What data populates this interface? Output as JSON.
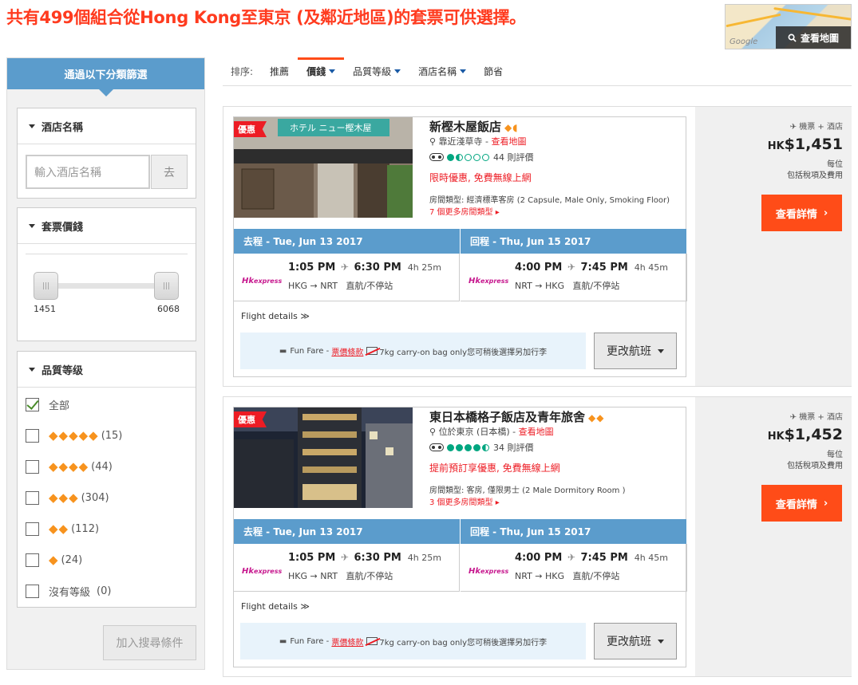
{
  "page_title": "共有499個組合從Hong Kong至東京 (及鄰近地區)的套票可供選擇。",
  "map": {
    "button_label": "查看地圖",
    "logo": "Google"
  },
  "sidebar": {
    "header": "通過以下分類篩選",
    "hotel_name": {
      "title": "酒店名稱",
      "placeholder": "輸入酒店名稱",
      "go_label": "去"
    },
    "price": {
      "title": "套票價錢",
      "min": "1451",
      "max": "6068"
    },
    "stars": {
      "title": "品質等级",
      "options": [
        {
          "label": "全部",
          "diamonds": "",
          "count": "",
          "checked": true
        },
        {
          "label": "",
          "diamonds": "◆◆◆◆◆",
          "count": "(15)",
          "checked": false
        },
        {
          "label": "",
          "diamonds": "◆◆◆◆",
          "count": "(44)",
          "checked": false
        },
        {
          "label": "",
          "diamonds": "◆◆◆",
          "count": "(304)",
          "checked": false
        },
        {
          "label": "",
          "diamonds": "◆◆",
          "count": "(112)",
          "checked": false
        },
        {
          "label": "",
          "diamonds": "◆",
          "count": "(24)",
          "checked": false
        },
        {
          "label": "沒有等級",
          "diamonds": "",
          "count": "(0)",
          "checked": false
        }
      ]
    },
    "add_button": "加入搜尋條件"
  },
  "sort": {
    "label": "排序:",
    "items": [
      "推薦",
      "價錢",
      "品質等級",
      "酒店名稱",
      "節省"
    ]
  },
  "results": [
    {
      "promo": "優惠",
      "name": "新樫木屋飯店",
      "diamonds": "◆◖",
      "location": "靠近淺草寺",
      "map_link": "查看地圖",
      "reviews": "44 則評價",
      "deal": "限時優惠, 免費無線上網",
      "room_type": "房間類型: 經濟標準客房 (2 Capsule, Male Only, Smoking Floor)",
      "more_rooms": "7 個更多房間類型 ▸",
      "outbound": {
        "header": "去程 - Tue, Jun 13 2017",
        "depart": "1:05 PM",
        "arrive": "6:30 PM",
        "duration": "4h 25m",
        "route": "HKG → NRT",
        "stops": "直航/不停站"
      },
      "inbound": {
        "header": "回程 - Thu, Jun 15 2017",
        "depart": "4:00 PM",
        "arrive": "7:45 PM",
        "duration": "4h 45m",
        "route": "NRT → HKG",
        "stops": "直航/不停站"
      },
      "flight_details": "Flight details ≫",
      "fare_name": "Fun Fare -",
      "fare_link": "票價條款",
      "baggage": "7kg carry-on bag only您可稍後選擇另加行李",
      "change_button": "更改航班",
      "package_label": "機票 + 酒店",
      "currency": "HK",
      "price": "$1,451",
      "per_person": "每位",
      "tax_note": "包括稅項及費用",
      "detail_button": "查看詳情"
    },
    {
      "promo": "優惠",
      "name": "東日本橋格子飯店及青年旅舍",
      "diamonds": "◆◆",
      "location": "位於東京 (日本橋)",
      "map_link": "查看地圖",
      "reviews": "34 則評價",
      "deal": "提前預訂享優惠, 免費無線上網",
      "room_type": "房間類型: 客房, 僅限男士 (2 Male Dormitory Room )",
      "more_rooms": "3 個更多房間類型 ▸",
      "outbound": {
        "header": "去程 - Tue, Jun 13 2017",
        "depart": "1:05 PM",
        "arrive": "6:30 PM",
        "duration": "4h 25m",
        "route": "HKG → NRT",
        "stops": "直航/不停站"
      },
      "inbound": {
        "header": "回程 - Thu, Jun 15 2017",
        "depart": "4:00 PM",
        "arrive": "7:45 PM",
        "duration": "4h 45m",
        "route": "NRT → HKG",
        "stops": "直航/不停站"
      },
      "flight_details": "Flight details ≫",
      "fare_name": "Fun Fare -",
      "fare_link": "票價條款",
      "baggage": "7kg carry-on bag only您可稍後選擇另加行李",
      "change_button": "更改航班",
      "package_label": "機票 + 酒店",
      "currency": "HK",
      "price": "$1,452",
      "per_person": "每位",
      "tax_note": "包括稅項及費用",
      "detail_button": "查看詳情"
    }
  ],
  "airline": {
    "prefix": "Hk",
    "name": "express"
  },
  "colors": {
    "brand_red": "#ff3b1f",
    "accent_blue": "#5b9ccc",
    "cta_orange": "#ff4c18",
    "diamond": "#f7931e"
  }
}
